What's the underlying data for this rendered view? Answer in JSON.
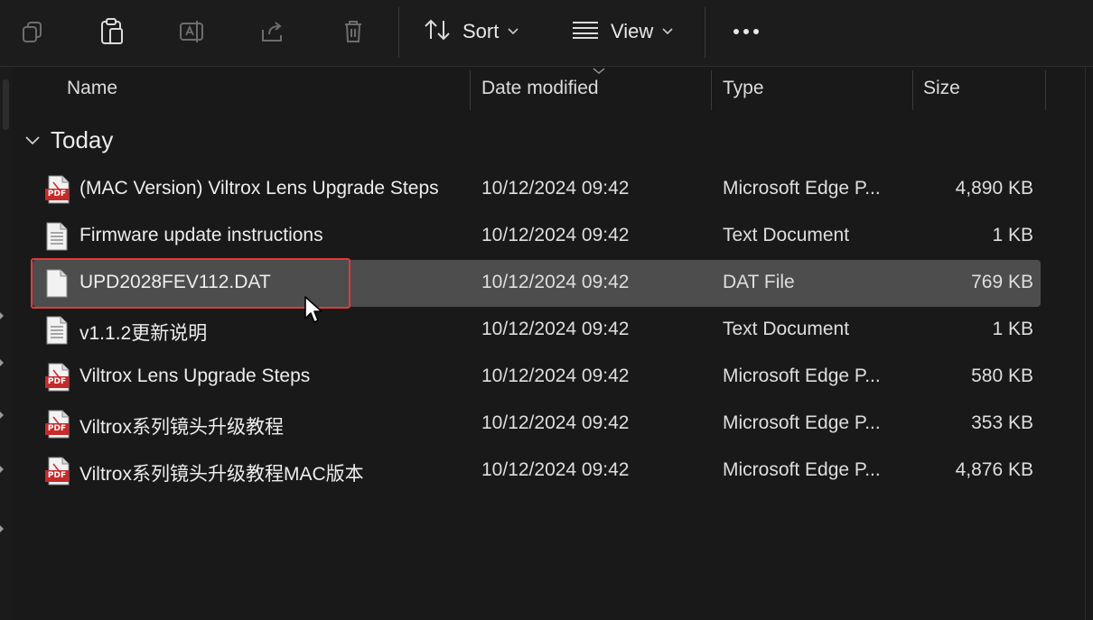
{
  "toolbar": {
    "sort_label": "Sort",
    "view_label": "View",
    "icons": [
      "copy-icon",
      "paste-icon",
      "rename-icon",
      "share-icon",
      "delete-icon",
      "sort-icon",
      "view-icon",
      "more-icon"
    ]
  },
  "columns": {
    "name": "Name",
    "date_modified": "Date modified",
    "type": "Type",
    "size": "Size"
  },
  "group": {
    "label": "Today"
  },
  "files": [
    {
      "name": "(MAC Version) Viltrox Lens Upgrade Steps",
      "date": "10/12/2024 09:42",
      "type": "Microsoft Edge P...",
      "size": "4,890 KB",
      "icon": "pdf-file-icon",
      "selected": false
    },
    {
      "name": "Firmware update instructions",
      "date": "10/12/2024 09:42",
      "type": "Text Document",
      "size": "1 KB",
      "icon": "text-file-icon",
      "selected": false
    },
    {
      "name": "UPD2028FEV112.DAT",
      "date": "10/12/2024 09:42",
      "type": "DAT File",
      "size": "769 KB",
      "icon": "blank-file-icon",
      "selected": true
    },
    {
      "name": "v1.1.2更新说明",
      "date": "10/12/2024 09:42",
      "type": "Text Document",
      "size": "1 KB",
      "icon": "text-file-icon",
      "selected": false
    },
    {
      "name": "Viltrox Lens Upgrade Steps",
      "date": "10/12/2024 09:42",
      "type": "Microsoft Edge P...",
      "size": "580 KB",
      "icon": "pdf-file-icon",
      "selected": false
    },
    {
      "name": "Viltrox系列镜头升级教程",
      "date": "10/12/2024 09:42",
      "type": "Microsoft Edge P...",
      "size": "353 KB",
      "icon": "pdf-file-icon",
      "selected": false
    },
    {
      "name": "Viltrox系列镜头升级教程MAC版本",
      "date": "10/12/2024 09:42",
      "type": "Microsoft Edge P...",
      "size": "4,876 KB",
      "icon": "pdf-file-icon",
      "selected": false
    }
  ],
  "colors": {
    "background": "#191919",
    "selection": "#4d4d4d",
    "highlight_outline": "#e03a3a",
    "pdf_red": "#c62a2a"
  }
}
